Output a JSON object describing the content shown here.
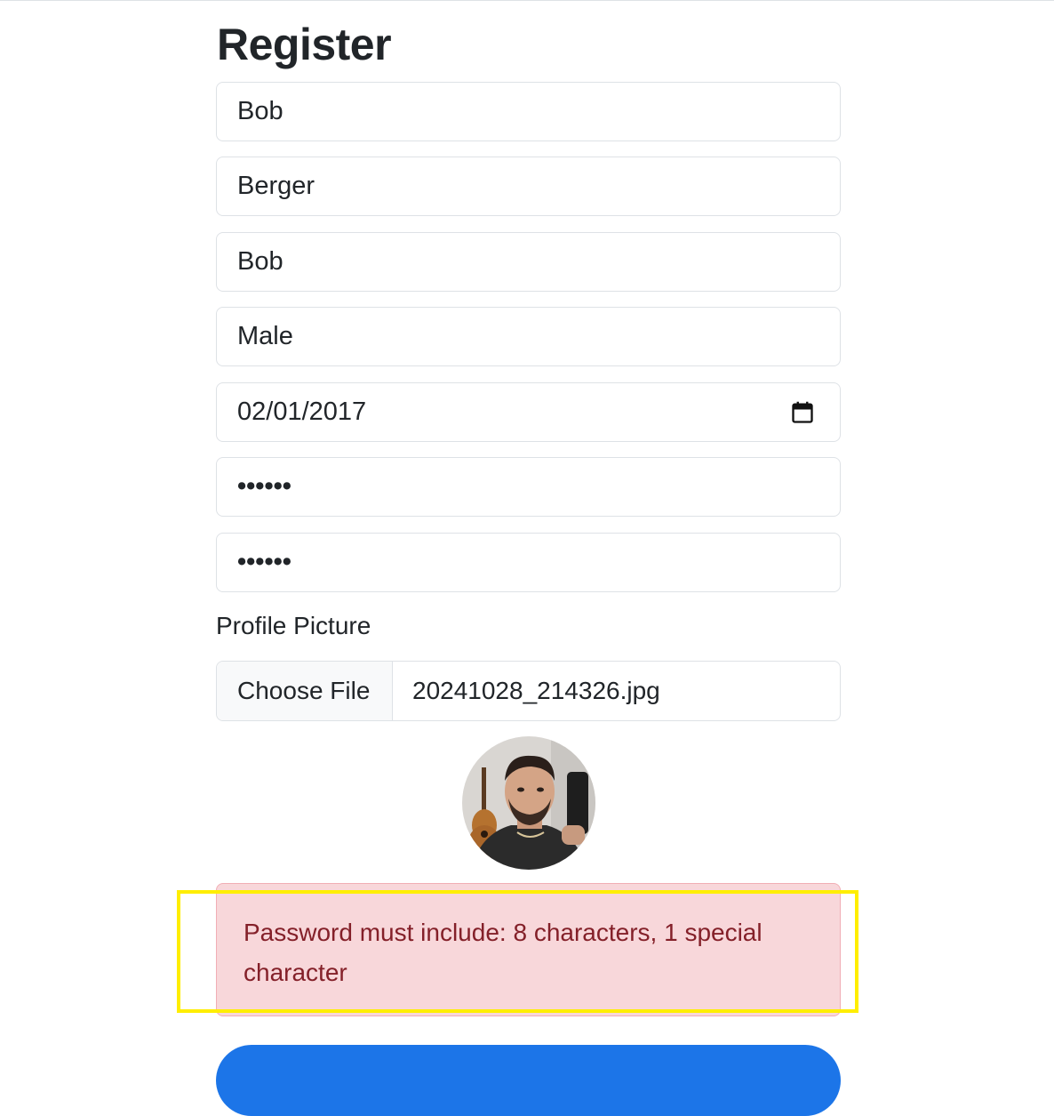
{
  "page": {
    "title": "Register"
  },
  "form": {
    "first_name": "Bob",
    "last_name": "Berger",
    "username": "Bob",
    "gender": "Male",
    "birth_date": "02/01/2017",
    "password": "••••••",
    "confirm_password": "••••••",
    "profile_picture_label": "Profile Picture",
    "choose_file_label": "Choose File",
    "file_name": "20241028_214326.jpg"
  },
  "alert": {
    "message": "Password must include: 8 characters, 1 special character"
  },
  "colors": {
    "alert_bg": "#f8d7da",
    "alert_text": "#842029",
    "primary": "#1c75e8",
    "highlight": "#ffee00"
  },
  "icons": {
    "date_picker": "calendar-icon"
  }
}
